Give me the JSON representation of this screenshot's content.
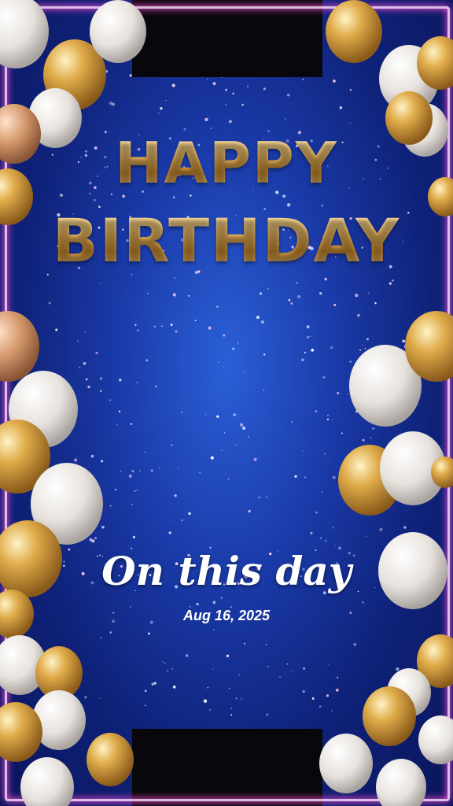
{
  "title": {
    "line1": "HAPPY",
    "line2": "BIRTHDAY"
  },
  "caption": {
    "heading": "On this day",
    "date": "Aug 16, 2025"
  },
  "colors": {
    "background": "#1a3aa8",
    "gold": "#e8b85a",
    "neon": "#ff4fd8",
    "text": "#ffffff"
  },
  "decor": {
    "balloon_colors": [
      "gold",
      "white",
      "silver"
    ],
    "frame": "neon-pink-rectangle"
  }
}
